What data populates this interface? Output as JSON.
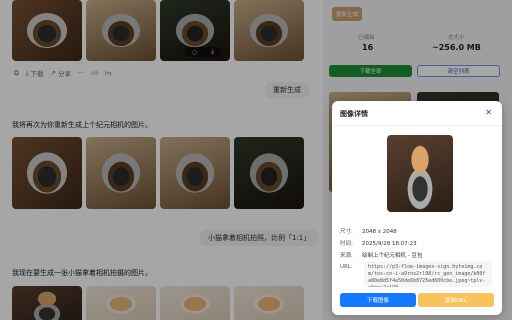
{
  "chat": {
    "toolbar": {
      "download_label": "下载",
      "share_label": "分享"
    },
    "user_messages": [
      "重新生成",
      "小猫拿着相机拍照，比例「1:1」"
    ],
    "assistant_messages": [
      "我将再次为你重新生成上个纪元相机的图片。",
      "我现在要生成一张小猫拿着相机拍摄的图片。"
    ]
  },
  "sidebar": {
    "regenerate_label": "重新生成",
    "stats": [
      {
        "label": "已编辑",
        "value": "16"
      },
      {
        "label": "总大小",
        "value": "~256.0 MB"
      }
    ],
    "download_all_label": "下载全部",
    "clear_all_label": "清空列表"
  },
  "modal": {
    "title": "图像详情",
    "close_icon": "close-icon",
    "info": [
      {
        "key": "尺寸:",
        "value": "2048 x 2048"
      },
      {
        "key": "时间:",
        "value": "2025/9/28 18:07:23"
      },
      {
        "key": "来源:",
        "value": "绘制上个纪元相机 - 豆包"
      }
    ],
    "url_label": "URL:",
    "url_value": "https://p3-flow-imagex-sign.byteimg.com/tos-cn-i-a9rns2rl98/rc_gen_image/b00fa80e8d5f4e50de6b8725ed600cbe.jpeg~tplv-a9rns2rl98",
    "download_label": "下载图像",
    "copy_url_label": "复制URL"
  }
}
